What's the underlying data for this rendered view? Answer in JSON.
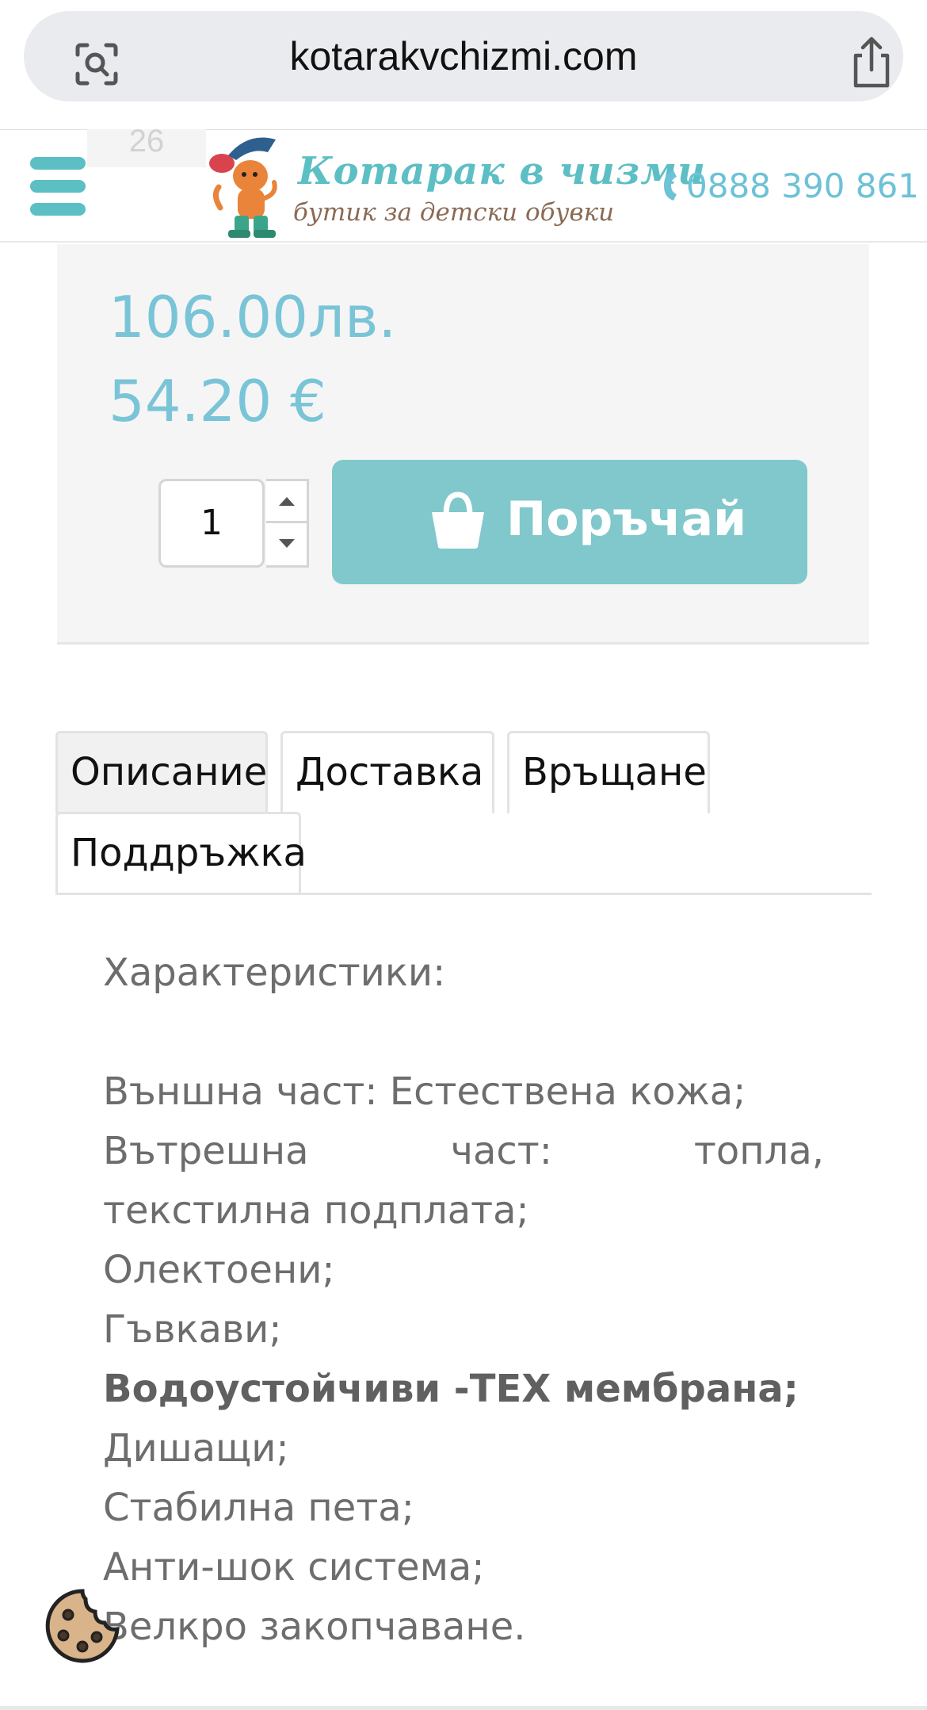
{
  "browser": {
    "url": "kotarakvchizmi.com"
  },
  "header": {
    "size_ghost": "26",
    "logo_title": "Котарак в чизми",
    "logo_subtitle": "бутик за детски обувки",
    "phone": "0888 390 861"
  },
  "product": {
    "price_bgn": "106.00лв.",
    "price_eur": "54.20 €",
    "quantity": "1",
    "order_label": "Поръчай"
  },
  "tabs": {
    "items": [
      {
        "label": "Описание"
      },
      {
        "label": "Доставка"
      },
      {
        "label": "Връщане"
      },
      {
        "label": "Поддръжка"
      }
    ]
  },
  "description": {
    "heading": "Характеристики:",
    "lines": [
      "Външна част: Естествена кожа;",
      "Вътрешна",
      "част:",
      "топла,",
      "текстилна подплата;",
      "Олектоени;",
      "Гъвкави;",
      "Водоустойчиви -TEX мембрана;",
      "Дишащи;",
      "Стабилна пета;",
      "Анти-шок система;",
      "Велкро закопчаване."
    ]
  },
  "colors": {
    "accent": "#80c8cb",
    "price": "#7ac4d7",
    "menu": "#5bbfc3"
  }
}
